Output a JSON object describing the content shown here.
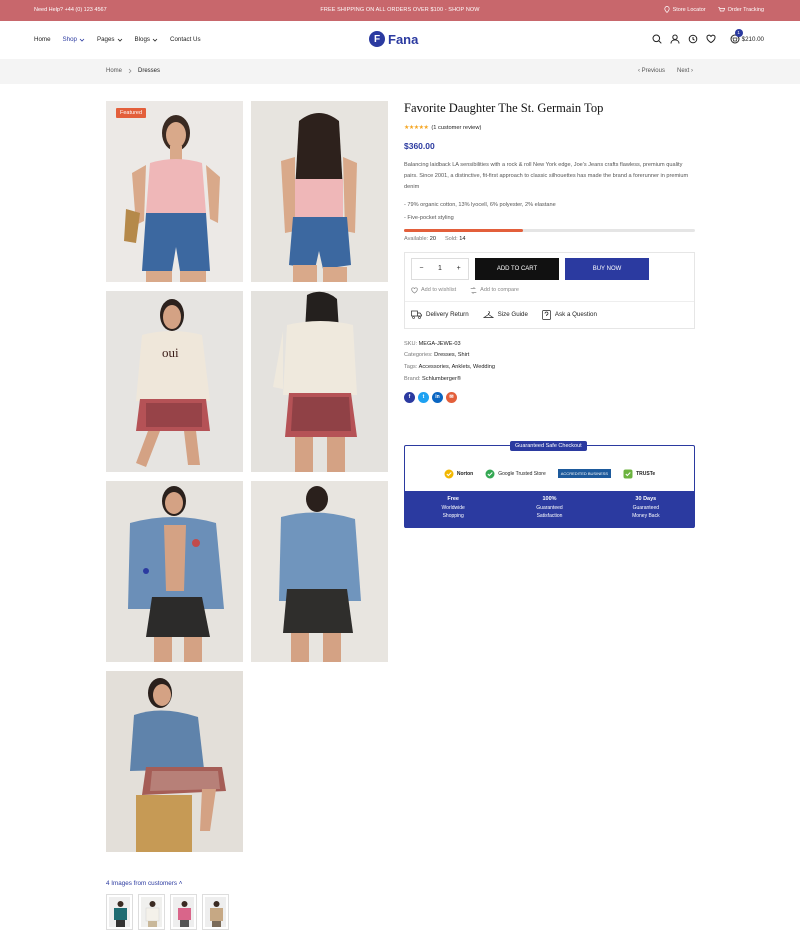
{
  "topbar": {
    "help": "Need Help? +44 (0) 123 4567",
    "promo": "FREE SHIPPING ON ALL ORDERS OVER $100  -  SHOP NOW",
    "store": "Store Locator",
    "tracking": "Order Tracking"
  },
  "brand": {
    "name": "Fana",
    "mark": "F"
  },
  "nav": {
    "items": [
      "Home",
      "Shop",
      "Pages",
      "Blogs",
      "Contact Us"
    ]
  },
  "cart": {
    "count": "1",
    "total": "$210.00"
  },
  "breadcrumb": {
    "home": "Home",
    "current": "Dresses",
    "prev": "Previous",
    "next": "Next"
  },
  "gallery": {
    "badge": "Featured",
    "customers": "4 Images from customers"
  },
  "product": {
    "title": "Favorite Daughter The St. Germain Top",
    "stars": "★★★★★",
    "reviews": "(1 customer review)",
    "price": "$360.00",
    "description": "Balancing laidback LA sensibilities with a rock & roll New York edge, Joe's Jeans crafts flawless, premium quality pairs. Since 2001, a distinctive, fit-first approach to classic silhouettes has made the brand a forerunner in premium denim",
    "bullets": [
      "79% organic cotton, 13% lyocell, 6% polyester, 2% elastane",
      "Five-pocket styling"
    ],
    "sold_fraction": 0.41,
    "available_label": "Available:",
    "available": "20",
    "sold_label": "Sold:",
    "sold": "14",
    "qty": "1",
    "add_to_cart": "ADD TO CART",
    "buy_now": "BUY NOW",
    "wishlist": "Add to wishlist",
    "compare": "Add to compare",
    "delivery": "Delivery Return",
    "size_guide": "Size Guide",
    "ask": "Ask a Question",
    "sku_label": "SKU:",
    "sku": "MEGA-JEWE-03",
    "categories_label": "Categories:",
    "categories": "Dresses, Shirt",
    "tags_label": "Tags:",
    "tags": "Accessories, Anklets, Wedding",
    "brand_label": "Brand:",
    "brand": "Schlumberger®"
  },
  "checkout": {
    "label": "Guaranteed Safe Checkout",
    "logos": [
      "Norton",
      "Google Trusted Store",
      "ACCREDITED BUSINESS",
      "TRUSTe"
    ],
    "features": [
      {
        "title": "Free",
        "l1": "Worldwide",
        "l2": "Shopping"
      },
      {
        "title": "100%",
        "l1": "Guaranteed",
        "l2": "Satisfaction"
      },
      {
        "title": "30 Days",
        "l1": "Guaranteed",
        "l2": "Money Back"
      }
    ]
  },
  "colors": {
    "topbar": "#c8676c",
    "accent": "#2b3aa0",
    "badge": "#e35f3b"
  }
}
